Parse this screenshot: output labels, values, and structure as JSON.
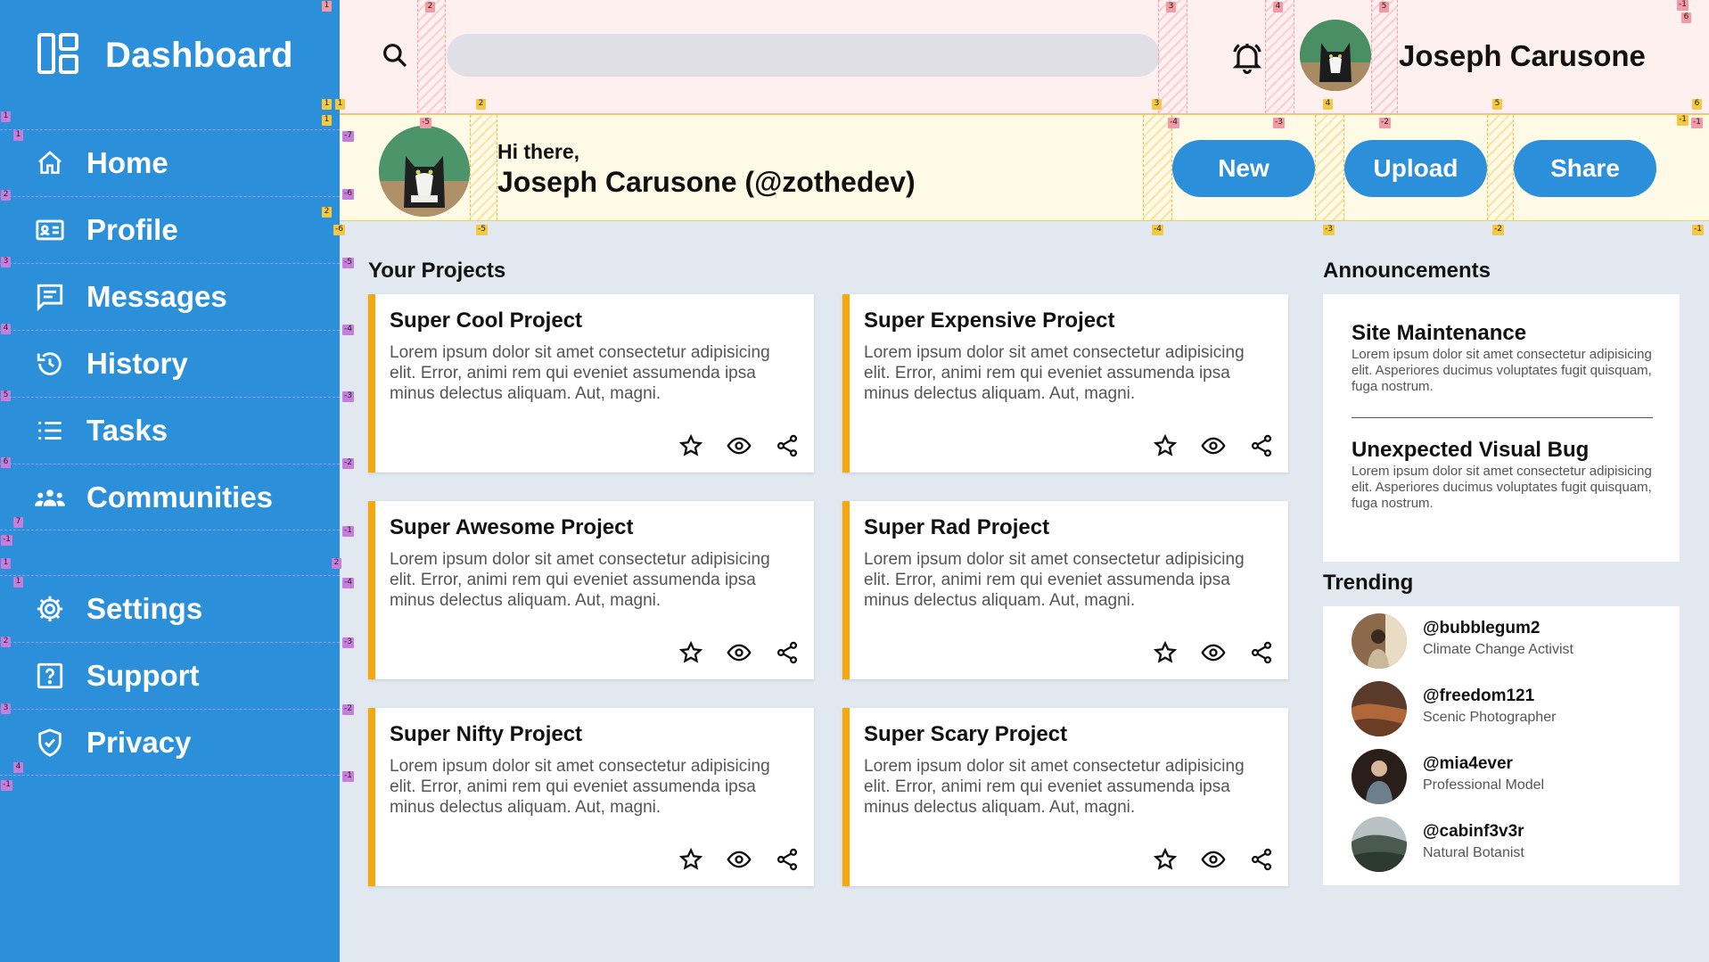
{
  "app": {
    "title": "Dashboard"
  },
  "sidebar": {
    "items": [
      {
        "label": "Home",
        "icon": "home-icon"
      },
      {
        "label": "Profile",
        "icon": "id-card-icon"
      },
      {
        "label": "Messages",
        "icon": "message-icon"
      },
      {
        "label": "History",
        "icon": "history-icon"
      },
      {
        "label": "Tasks",
        "icon": "list-icon"
      },
      {
        "label": "Communities",
        "icon": "people-icon"
      }
    ],
    "secondary": [
      {
        "label": "Settings",
        "icon": "gear-icon"
      },
      {
        "label": "Support",
        "icon": "help-icon"
      },
      {
        "label": "Privacy",
        "icon": "shield-icon"
      }
    ]
  },
  "header": {
    "search": {
      "value": "",
      "placeholder": ""
    },
    "username": "Joseph Carusone"
  },
  "greeting": {
    "hi": "Hi there,",
    "name": "Joseph Carusone (@zothedev)",
    "buttons": {
      "new": "New",
      "upload": "Upload",
      "share": "Share"
    }
  },
  "projects": {
    "title": "Your Projects",
    "items": [
      {
        "title": "Super Cool Project",
        "desc": "Lorem ipsum dolor sit amet consectetur adipisicing elit. Error, animi rem qui eveniet assumenda ipsa minus delectus aliquam. Aut, magni."
      },
      {
        "title": "Super Expensive Project",
        "desc": "Lorem ipsum dolor sit amet consectetur adipisicing elit. Error, animi rem qui eveniet assumenda ipsa minus delectus aliquam. Aut, magni."
      },
      {
        "title": "Super Awesome Project",
        "desc": "Lorem ipsum dolor sit amet consectetur adipisicing elit. Error, animi rem qui eveniet assumenda ipsa minus delectus aliquam. Aut, magni."
      },
      {
        "title": "Super Rad Project",
        "desc": "Lorem ipsum dolor sit amet consectetur adipisicing elit. Error, animi rem qui eveniet assumenda ipsa minus delectus aliquam. Aut, magni."
      },
      {
        "title": "Super Nifty Project",
        "desc": "Lorem ipsum dolor sit amet consectetur adipisicing elit. Error, animi rem qui eveniet assumenda ipsa minus delectus aliquam. Aut, magni."
      },
      {
        "title": "Super Scary Project",
        "desc": "Lorem ipsum dolor sit amet consectetur adipisicing elit. Error, animi rem qui eveniet assumenda ipsa minus delectus aliquam. Aut, magni."
      }
    ]
  },
  "announcements": {
    "title": "Announcements",
    "items": [
      {
        "title": "Site Maintenance",
        "body": "Lorem ipsum dolor sit amet consectetur adipisicing elit. Asperiores ducimus voluptates fugit quisquam, fuga nostrum."
      },
      {
        "title": "Unexpected Visual Bug",
        "body": "Lorem ipsum dolor sit amet consectetur adipisicing elit. Asperiores ducimus voluptates fugit quisquam, fuga nostrum."
      }
    ]
  },
  "trending": {
    "title": "Trending",
    "items": [
      {
        "handle": "@bubblegum2",
        "role": "Climate Change Activist"
      },
      {
        "handle": "@freedom121",
        "role": "Scenic Photographer"
      },
      {
        "handle": "@mia4ever",
        "role": "Professional Model"
      },
      {
        "handle": "@cabinf3v3r",
        "role": "Natural Botanist"
      }
    ]
  },
  "colors": {
    "sidebar": "#2b90d9",
    "accent_button": "#2b90d9",
    "card_accent": "#f6a70d",
    "background": "#e2e8f0"
  }
}
